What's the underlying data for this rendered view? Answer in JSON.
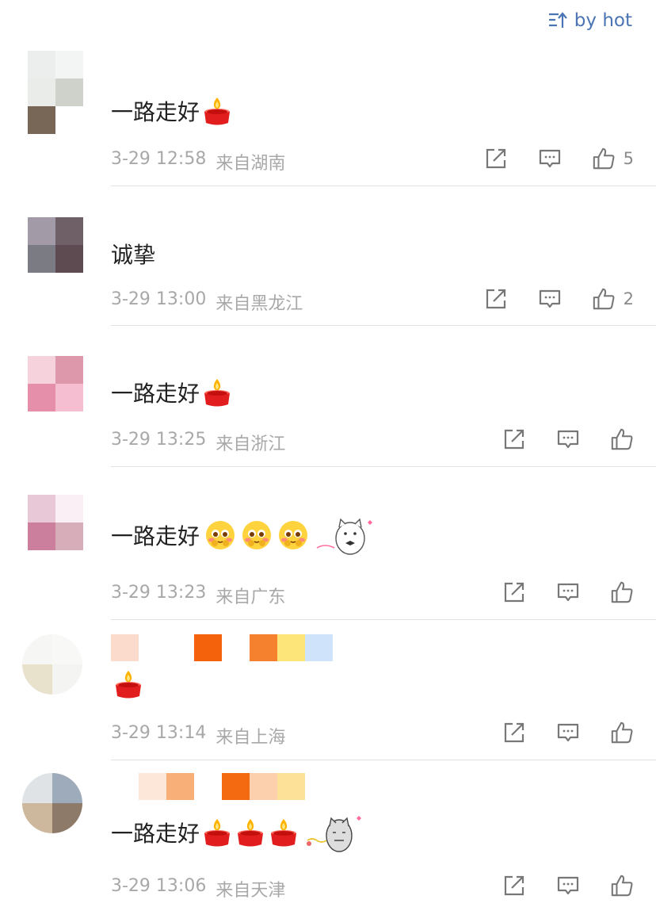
{
  "header": {
    "sort_label": "by hot"
  },
  "comments": [
    {
      "text": "一路走好",
      "time": "3-29 12:58",
      "location": "来自湖南",
      "likes": "5"
    },
    {
      "text": "诚挚",
      "time": "3-29 13:00",
      "location": "来自黑龙江",
      "likes": "2"
    },
    {
      "text": "一路走好",
      "time": "3-29 13:25",
      "location": "来自浙江",
      "likes": ""
    },
    {
      "text": "一路走好",
      "time": "3-29 13:23",
      "location": "来自广东",
      "likes": ""
    },
    {
      "text": "",
      "time": "3-29 13:14",
      "location": "来自上海",
      "likes": ""
    },
    {
      "text": "一路走好",
      "time": "3-29 13:06",
      "location": "来自天津",
      "likes": ""
    }
  ],
  "icons": {
    "sort": "sort-icon",
    "share": "share-icon",
    "reply": "comment-icon",
    "like": "thumbs-up-icon",
    "candle": "candle-emoji",
    "blush": "blush-emoji",
    "cat": "cat-sticker"
  },
  "colors": {
    "accent": "#4a74b3",
    "meta": "#a8a8a8",
    "divider": "#e3e3e3"
  }
}
